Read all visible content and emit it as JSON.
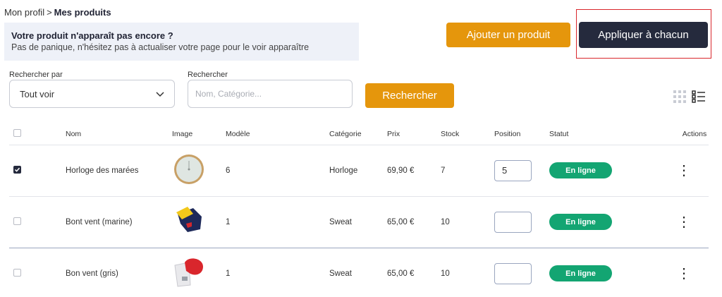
{
  "breadcrumb": {
    "parent": "Mon profil",
    "separator": ">",
    "current": "Mes produits"
  },
  "info": {
    "title": "Votre produit n'apparaît pas encore ?",
    "text": "Pas de panique, n'hésitez pas à actualiser votre page pour le voir apparaître"
  },
  "buttons": {
    "add": "Ajouter un produit",
    "apply": "Appliquer à chacun",
    "search": "Rechercher"
  },
  "filters": {
    "search_by_label": "Rechercher par",
    "search_by_value": "Tout voir",
    "search_label": "Rechercher",
    "search_placeholder": "Nom, Catégorie..."
  },
  "table": {
    "headers": {
      "name": "Nom",
      "image": "Image",
      "model": "Modèle",
      "category": "Catégorie",
      "price": "Prix",
      "stock": "Stock",
      "position": "Position",
      "status": "Statut",
      "actions": "Actions"
    },
    "rows": [
      {
        "checked": true,
        "name": "Horloge des marées",
        "image": "clock-image",
        "model": "6",
        "category": "Horloge",
        "price": "69,90 €",
        "stock": "7",
        "position": "5",
        "status": "En ligne"
      },
      {
        "checked": false,
        "name": "Bont vent (marine)",
        "image": "navy-sweat-image",
        "model": "1",
        "category": "Sweat",
        "price": "65,00 €",
        "stock": "10",
        "position": "",
        "status": "En ligne"
      },
      {
        "checked": false,
        "name": "Bon vent (gris)",
        "image": "grey-sweat-image",
        "model": "1",
        "category": "Sweat",
        "price": "65,00 €",
        "stock": "10",
        "position": "",
        "status": "En ligne"
      }
    ]
  },
  "colors": {
    "accent": "#e5960c",
    "dark": "#252a3d",
    "status_online": "#13a572",
    "highlight": "#d9262c"
  }
}
